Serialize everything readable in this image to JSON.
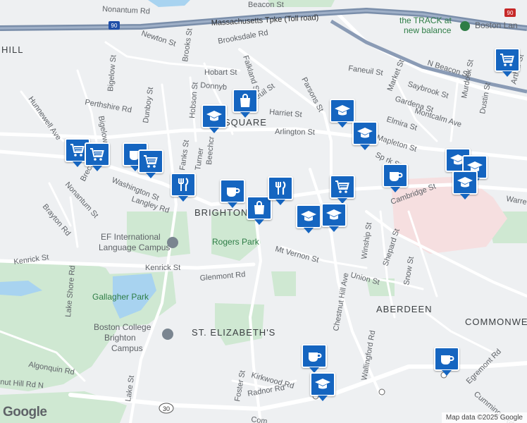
{
  "map": {
    "areas": {
      "hill": "HILL",
      "square": "SQUARE",
      "brighton": "BRIGHTON",
      "aberdeen": "ABERDEEN",
      "st_elizabeths": "ST. ELIZABETH'S",
      "commonwealth": "COMMONWE"
    },
    "streets": {
      "nonantum_top": "Nonantum Rd",
      "beacon": "Beacon St",
      "pike": "Massachusetts Tpke (Toll road)",
      "newton": "Newton St",
      "brooks": "Brooks St",
      "brooksdale": "Brooksdale Rd",
      "falkland": "Falkland St",
      "hobart": "Hobart St",
      "donnybrook": "Donnyb",
      "faneuil_mid": "Faneuil St",
      "faneuil_right": "Faneuil St",
      "n_beacon": "N Beacon St",
      "market": "Market St",
      "saybrook": "Saybrook St",
      "gardena": "Gardena St",
      "montcalm": "Montcalm Ave",
      "elmira": "Elmira St",
      "mapleton": "Mapleton St",
      "murdock": "Murdock St",
      "dustin": "Dustin St",
      "parsons": "Parsons St",
      "harriet": "Harriet St",
      "arlington": "Arlington St",
      "bigelow": "Bigelow St",
      "perthshire": "Perthshire Rd",
      "dunboy": "Dunboy St",
      "hunnewell": "Hunnewell Ave",
      "bigelow2": "Bigelow",
      "hobson": "Hobson St",
      "fanks": "Fanks St",
      "turner": "Turner",
      "beechcroft": "Beechcr",
      "washington": "Washington St",
      "nonantum2": "Nonantum St",
      "breck": "Breck Ave",
      "langley": "Langley Rd",
      "brayton": "Brayton Rd",
      "kenrick_left": "Kenrick St",
      "kenrick": "Kenrick St",
      "glenmont": "Glenmont Rd",
      "mt_vernon": "Mt Vernon St",
      "chestnut_hill": "Chestnut Hill Ave",
      "winship": "Winship St",
      "shepard": "Shepard St",
      "snow": "Snow St",
      "union": "Union St",
      "cambridge": "Cambridge St",
      "warren": "Warre",
      "spark": "Sp  rk St",
      "lake_shore": "Lake Shore Rd",
      "algonquin": "Algonquin Rd",
      "chestnut_hill_rd": "nut Hill Rd N",
      "lake": "Lake St",
      "foster": "Foster St",
      "kirkwood": "Kirkwood Rd",
      "radnor": "Radnor Rd",
      "wallingford": "Wallingford Rd",
      "egremont": "Egremont Rd",
      "cummings": "Cummings Rd",
      "commonwealth_bottom": "Com",
      "arthur": "Arthur St",
      "st_small": "St"
    },
    "route_shields": {
      "i90_left": "90",
      "i90_right": "90",
      "rt30": "30"
    },
    "parks": {
      "rogers": "Rogers Park",
      "gallagher": "Gallagher Park"
    },
    "pois": {
      "track_line1": "the TRACK at",
      "track_line2": "new balance",
      "boston_landing": "Boston Lan",
      "ef_line1": "EF International",
      "ef_line2": "Language Campus",
      "bc_line1": "Boston College",
      "bc_line2": "Brighton",
      "bc_line3": "Campus"
    },
    "attribution": "Map data ©2025 Google",
    "logo": "Google",
    "colors": {
      "marker": "#1565c0",
      "park": "#c8e6c9",
      "water": "#a8d3f0",
      "highway": "#7a8eaa",
      "hospital": "#f8d7da"
    },
    "markers": [
      {
        "icon": "shopping-cart-icon",
        "cls": "m-cart"
      },
      {
        "icon": "shopping-bag-icon",
        "cls": "m-bag"
      },
      {
        "icon": "graduation-cap-icon",
        "cls": "m-cap"
      },
      {
        "icon": "graduation-cap-icon",
        "cls": "m-cap"
      },
      {
        "icon": "graduation-cap-icon",
        "cls": "m-cap"
      },
      {
        "icon": "shopping-cart-icon",
        "cls": "m-cart"
      },
      {
        "icon": "shopping-cart-icon",
        "cls": "m-cart"
      },
      {
        "icon": "coffee-cup-icon",
        "cls": "m-coffee"
      },
      {
        "icon": "shopping-cart-icon",
        "cls": "m-cart"
      },
      {
        "icon": "fork-knife-icon",
        "cls": "m-food"
      },
      {
        "icon": "coffee-cup-icon",
        "cls": "m-coffee"
      },
      {
        "icon": "shopping-bag-icon",
        "cls": "m-bag"
      },
      {
        "icon": "fork-knife-icon",
        "cls": "m-food"
      },
      {
        "icon": "shopping-cart-icon",
        "cls": "m-cart"
      },
      {
        "icon": "graduation-cap-icon",
        "cls": "m-cap"
      },
      {
        "icon": "coffee-cup-icon",
        "cls": "m-coffee"
      },
      {
        "icon": "graduation-cap-icon",
        "cls": "m-cap"
      },
      {
        "icon": "graduation-cap-icon",
        "cls": "m-cap"
      },
      {
        "icon": "graduation-cap-icon",
        "cls": "m-cap"
      },
      {
        "icon": "graduation-cap-icon",
        "cls": "m-cap"
      },
      {
        "icon": "coffee-cup-icon",
        "cls": "m-coffee"
      },
      {
        "icon": "graduation-cap-icon",
        "cls": "m-cap"
      },
      {
        "icon": "coffee-cup-icon",
        "cls": "m-coffee"
      }
    ]
  }
}
